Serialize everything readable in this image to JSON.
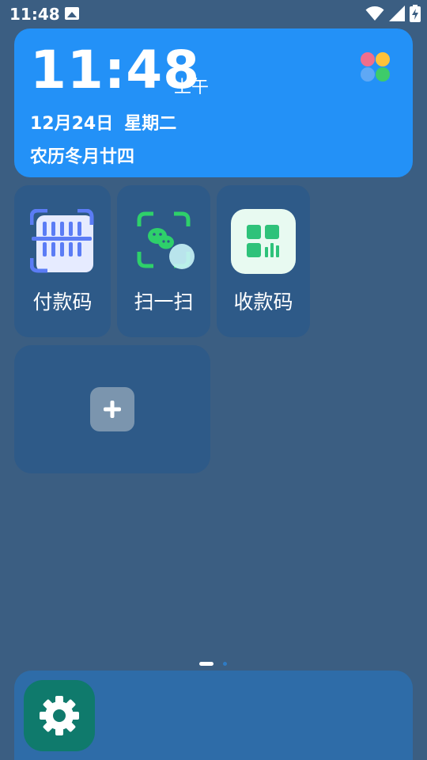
{
  "status_bar": {
    "time": "11:48",
    "icons": [
      "image-icon",
      "wifi-icon",
      "signal-icon",
      "battery-charging-icon"
    ]
  },
  "clock_widget": {
    "time": "11:48",
    "ampm": "上午",
    "date": "12月24日",
    "weekday": "星期二",
    "lunar": "农历冬月廿四",
    "app_icon": "color-petal-icon"
  },
  "shortcuts": [
    {
      "label": "付款码",
      "icon": "barcode-scan-icon"
    },
    {
      "label": "扫一扫",
      "icon": "wechat-scan-icon"
    },
    {
      "label": "收款码",
      "icon": "qr-grid-icon"
    }
  ],
  "add_tile": {
    "icon": "plus-icon"
  },
  "pager": {
    "pages": 2,
    "current": 1
  },
  "dock": {
    "apps": [
      {
        "icon": "settings-gear-icon"
      }
    ]
  },
  "colors": {
    "background": "#3b5e82",
    "clock_card": "#2391f7",
    "tile": "#2e5a88",
    "dock": "#2e6ca8",
    "settings_app": "#0f7a6c"
  }
}
